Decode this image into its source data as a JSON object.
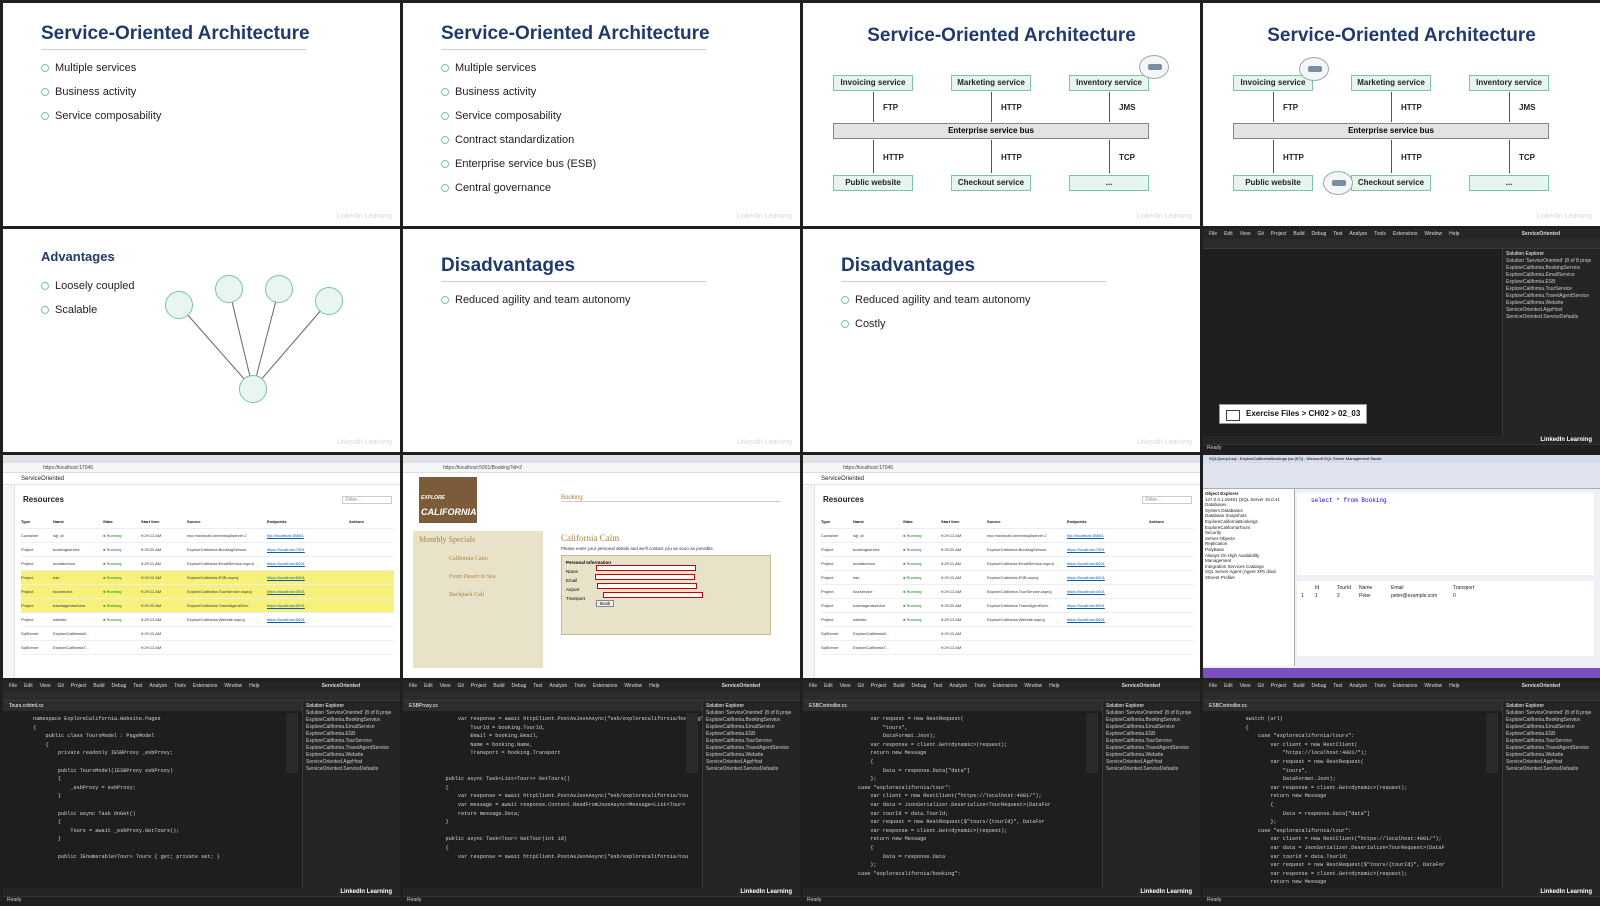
{
  "soa_title": "Service-Oriented Architecture",
  "soa_list_1": [
    "Multiple services",
    "Business activity",
    "Service composability"
  ],
  "soa_list_2": [
    "Multiple services",
    "Business activity",
    "Service composability",
    "Contract standardization",
    "Enterprise service bus (ESB)",
    "Central governance"
  ],
  "diagram": {
    "top": [
      "Invoicing service",
      "Marketing service",
      "Inventory service"
    ],
    "top_proto": [
      "FTP",
      "HTTP",
      "JMS"
    ],
    "bus": "Enterprise service bus",
    "bottom_proto": [
      "HTTP",
      "HTTP",
      "TCP"
    ],
    "bottom": [
      "Public website",
      "Checkout service",
      "..."
    ]
  },
  "advantages": {
    "title": "Advantages",
    "items": [
      "Loosely coupled",
      "Scalable"
    ]
  },
  "disadvantages_1": {
    "title": "Disadvantages",
    "items": [
      "Reduced agility and team autonomy"
    ]
  },
  "disadvantages_2": {
    "title": "Disadvantages",
    "items": [
      "Reduced agility and team autonomy",
      "Costly"
    ]
  },
  "watermark": "LinkedIn Learning",
  "ide": {
    "menu": [
      "File",
      "Edit",
      "View",
      "Git",
      "Project",
      "Build",
      "Debug",
      "Test",
      "Analyze",
      "Tools",
      "Extensions",
      "Window",
      "Help"
    ],
    "solution_name": "ServiceOriented",
    "exercise_path": "Exercise Files > CH02 > 02_03",
    "status": "Ready",
    "brand": "LinkedIn Learning",
    "solution_items": [
      "Solution 'ServiceOriented' (8 of 8 proje",
      "ExploreCalifornia.BookingService",
      "ExploreCalifornia.EmailService",
      "ExploreCalifornia.ESB",
      "ExploreCalifornia.TourService",
      "ExploreCalifornia.TravelAgentService",
      "ExploreCalifornia.Website",
      "ServiceOriented.AppHost",
      "ServiceOriented.ServiceDefaults"
    ]
  },
  "code_tiles": [
    {
      "tab": "Tours.cshtml.cs",
      "lines": [
        "namespace ExploreCalifornia.Website.Pages",
        "{",
        "    public class ToursModel : PageModel",
        "    {",
        "        private readonly IESBProxy _esbProxy;",
        "",
        "        public ToursModel(IESBProxy esbProxy)",
        "        {",
        "            _esbProxy = esbProxy;",
        "        }",
        "",
        "        public async Task OnGet()",
        "        {",
        "            Tours = await _esbProxy.GetTours();",
        "        }",
        "",
        "        public IEnumerable<Tour> Tours { get; private set; }"
      ]
    },
    {
      "tab": "ESBProxy.cs",
      "lines": [
        "        var response = await httpClient.PostAsJsonAsync(\"esb/explorecalifornia/booking\", new Mess",
        "            TourId = booking.TourId,",
        "            Email = booking.Email,",
        "            Name = booking.Name,",
        "            Transport = booking.Transport",
        "",
        "",
        "    public async Task<List<Tour>> GetTours()",
        "    {",
        "        var response = await httpClient.PostAsJsonAsync(\"esb/explorecalifornia/tou",
        "        var message = await response.Content.ReadFromJsonAsync<Message<List<Tour>",
        "        return message.Data;",
        "    }",
        "",
        "    public async Task<Tour> GetTour(int id)",
        "    {",
        "        var response = await httpClient.PostAsJsonAsync(\"esb/explorecalifornia/tou"
      ]
    },
    {
      "tab": "ESBController.cs",
      "lines": [
        "            var request = new RestRequest(",
        "                \"tours\",",
        "                DataFormat.Json);",
        "            var response = client.Get<dynamic>(request);",
        "            return new Message",
        "            {",
        "                Data = response.Data[\"data\"]",
        "            };",
        "        case \"explorecalifornia/tour\":",
        "            var client = new RestClient(\"https://localhost:4001/\");",
        "            var data = JsonSerializer.Deserialize<TourRequest>(DataFor",
        "            var tourId = data.TourId;",
        "            var request = new RestRequest($\"tours/{tourId}\", DataFor",
        "            var response = client.Get<dynamic>(request);",
        "            return new Message",
        "            {",
        "                Data = response.Data",
        "            };",
        "        case \"explorecalifornia/booking\":"
      ]
    },
    {
      "tab": "ESBController.cs",
      "lines": [
        "    switch (url)",
        "    {",
        "        case \"explorecalifornia/tours\":",
        "            var client = new RestClient(",
        "                \"https://localhost:4001/\");",
        "            var request = new RestRequest(",
        "                \"tours\",",
        "                DataFormat.Json);",
        "            var response = client.Get<dynamic>(request);",
        "            return new Message",
        "            {",
        "                Data = response.Data[\"data\"]",
        "            };",
        "        case \"explorecalifornia/tour\":",
        "            var client = new RestClient(\"https://localhost:4001/\");",
        "            var data = JsonSerializer.Deserialize<TourRequest>(DataF",
        "            var tourId = data.TourId;",
        "            var request = new RestRequest($\"tours/{tourId}\", DataFor",
        "            var response = client.Get<dynamic>(request);",
        "            return new Message"
      ]
    }
  ],
  "dashboard": {
    "tab_title": "ServiceOriented resources",
    "url": "https://localhost:17046",
    "app_name": "ServiceOriented",
    "heading": "Resources",
    "filter_placeholder": "Filter...",
    "columns": [
      "Type",
      "Name",
      "State",
      "Start time",
      "Source",
      "Endpoints",
      "Actions"
    ],
    "rows": [
      [
        "Container",
        "sql_di",
        "Running",
        "9:29:12 AM",
        "mcr.microsoft.com/mssql/server:2",
        "tcp://localhost:55661",
        ""
      ],
      [
        "Project",
        "bookingservice",
        "Running",
        "9:29:20 AM",
        "ExploreCalifornia.BookingService.",
        "https://localhost:7001",
        ""
      ],
      [
        "Project",
        "emailservice",
        "Running",
        "9:29:11 AM",
        "ExploreCalifornia.EmailService.csproj",
        "https://localhost:6001",
        ""
      ],
      [
        "Project",
        "esb",
        "Running",
        "9:29:12 AM",
        "ExploreCalifornia.ESB.csproj",
        "https://localhost:6001",
        ""
      ],
      [
        "Project",
        "tourservice",
        "Running",
        "9:29:12 AM",
        "ExploreCalifornia.TourService.csproj",
        "https://localhost:4001",
        ""
      ],
      [
        "Project",
        "travelagentservice",
        "Running",
        "9:29:20 AM",
        "ExploreCalifornia.TravelAgentServ.",
        "https://localhost:8001",
        ""
      ],
      [
        "Project",
        "website",
        "Running",
        "9:29:13 AM",
        "ExploreCalifornia.Website.csproj",
        "https://localhost:5001",
        ""
      ],
      [
        "SqlServer",
        "ExploreCalifornia8...",
        "",
        "9:29:12 AM",
        "",
        "",
        ""
      ],
      [
        "SqlServer",
        "ExploreCalifornia7...",
        "",
        "9:29:12 AM",
        "",
        "",
        ""
      ]
    ]
  },
  "booking": {
    "tab_title": "Booking",
    "url": "https://localhost:5001/Booking?id=2",
    "logo_text": "CALIFORNIA",
    "logo_top": "EXPLORE",
    "nav": "Booking",
    "specials_title": "Monthly Specials",
    "specials": [
      "California Calm",
      "From Desert to Sea",
      "Backpack Cali"
    ],
    "form_title": "California Calm",
    "form_intro": "Please enter your personal details and we'll contact you as soon as possible.",
    "form_box_title": "Personal Information",
    "fields": [
      "Name",
      "Email",
      "Airport",
      "Transport"
    ],
    "button": "Book"
  },
  "sql": {
    "title": "SQLQuery4.sql - ExploreCaliforniaBookings (sa (67)) - Microsoft SQL Server Management Studio",
    "query": "select * from Booking",
    "tree": [
      "127.0.0.1,50461 (SQL Server 16.0.41",
      "Databases",
      "System Databases",
      "Database Snapshots",
      "ExploreCaliforniaBookings",
      "ExploreCaliforniaTours",
      "Security",
      "Server Objects",
      "Replication",
      "PolyBase",
      "Always On High Availability",
      "Management",
      "Integration Services Catalogs",
      "SQL Server Agent (Agent XPs disal",
      "XEvent Profiler"
    ],
    "result_cols": [
      "Id",
      "TourId",
      "Name",
      "Email",
      "Transport"
    ],
    "result_row": [
      "1",
      "2",
      "Peter",
      "peter@example.com",
      "0"
    ]
  }
}
